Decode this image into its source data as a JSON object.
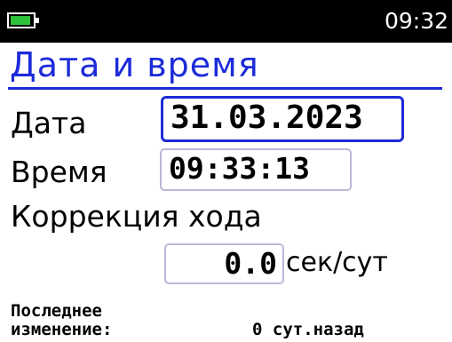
{
  "status": {
    "time": "09:32",
    "battery_icon": "battery-icon",
    "battery_color": "#2ec23a"
  },
  "title": "Дата и время",
  "date": {
    "label": "Дата",
    "value": "31.03.2023"
  },
  "time": {
    "label": "Время",
    "value": "09:33:13"
  },
  "correction": {
    "label": "Коррекция хода",
    "value": "0.0",
    "unit": "сек/сут"
  },
  "last_change": {
    "label_line1": "Последнее",
    "label_line2": "изменение:",
    "value": "0 сут.назад"
  },
  "colors": {
    "accent": "#1d2bd8",
    "field_border": "#bdb6d6",
    "statusbar": "#000000"
  }
}
